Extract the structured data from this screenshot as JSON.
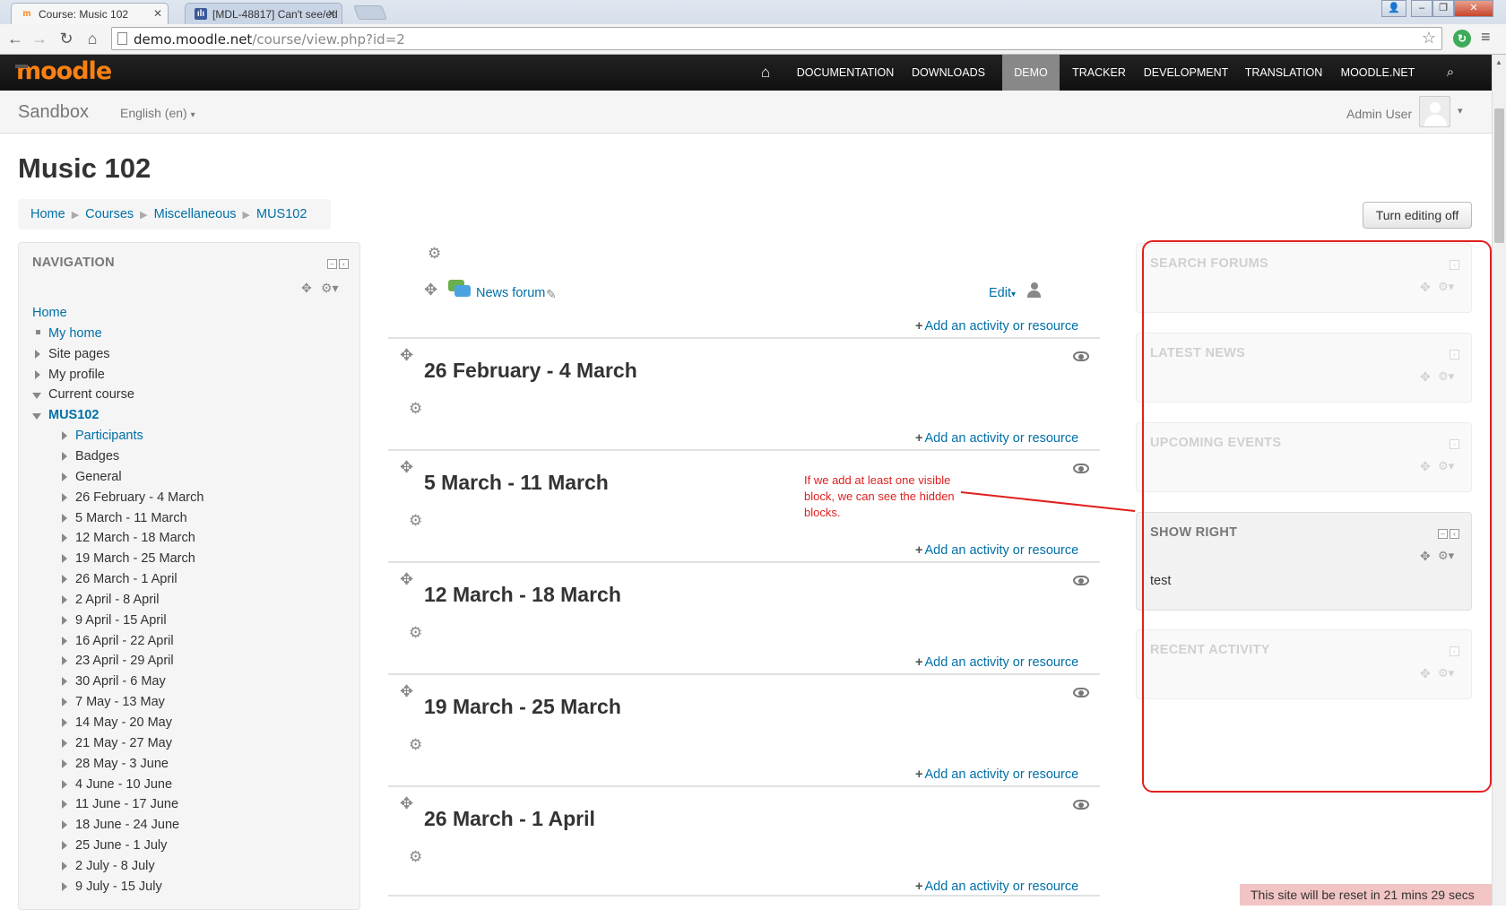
{
  "browser": {
    "tabs": [
      {
        "title": "Course: Music 102",
        "active": true
      },
      {
        "title": "[MDL-48817] Can't see/ed",
        "active": false
      }
    ],
    "url_domain": "demo.moodle.net",
    "url_path": "/course/view.php?id=2"
  },
  "header": {
    "logo": "moodle",
    "nav": [
      {
        "label": "DOCUMENTATION"
      },
      {
        "label": "DOWNLOADS"
      },
      {
        "label": "DEMO",
        "active": true
      },
      {
        "label": "TRACKER"
      },
      {
        "label": "DEVELOPMENT"
      },
      {
        "label": "TRANSLATION"
      },
      {
        "label": "MOODLE.NET"
      }
    ],
    "site_name": "Sandbox",
    "language": "English (en)",
    "user_name": "Admin User"
  },
  "page": {
    "title": "Music 102",
    "breadcrumb": [
      "Home",
      "Courses",
      "Miscellaneous",
      "MUS102"
    ],
    "editing_button": "Turn editing off"
  },
  "navigation_block": {
    "title": "NAVIGATION",
    "items": [
      {
        "label": "Home",
        "style": "link",
        "level": 0,
        "marker": "none"
      },
      {
        "label": "My home",
        "style": "link",
        "level": 1,
        "marker": "square"
      },
      {
        "label": "Site pages",
        "style": "plain",
        "level": 1,
        "marker": "collapsed"
      },
      {
        "label": "My profile",
        "style": "plain",
        "level": 1,
        "marker": "collapsed"
      },
      {
        "label": "Current course",
        "style": "plain",
        "level": 1,
        "marker": "expanded"
      },
      {
        "label": "MUS102",
        "style": "bold-link",
        "level": 2,
        "marker": "expanded"
      },
      {
        "label": "Participants",
        "style": "link",
        "level": 3,
        "marker": "collapsed"
      },
      {
        "label": "Badges",
        "style": "plain",
        "level": 3,
        "marker": "collapsed"
      },
      {
        "label": "General",
        "style": "plain",
        "level": 3,
        "marker": "collapsed"
      },
      {
        "label": "26 February - 4 March",
        "style": "plain",
        "level": 3,
        "marker": "collapsed"
      },
      {
        "label": "5 March - 11 March",
        "style": "plain",
        "level": 3,
        "marker": "collapsed"
      },
      {
        "label": "12 March - 18 March",
        "style": "plain",
        "level": 3,
        "marker": "collapsed"
      },
      {
        "label": "19 March - 25 March",
        "style": "plain",
        "level": 3,
        "marker": "collapsed"
      },
      {
        "label": "26 March - 1 April",
        "style": "plain",
        "level": 3,
        "marker": "collapsed"
      },
      {
        "label": "2 April - 8 April",
        "style": "plain",
        "level": 3,
        "marker": "collapsed"
      },
      {
        "label": "9 April - 15 April",
        "style": "plain",
        "level": 3,
        "marker": "collapsed"
      },
      {
        "label": "16 April - 22 April",
        "style": "plain",
        "level": 3,
        "marker": "collapsed"
      },
      {
        "label": "23 April - 29 April",
        "style": "plain",
        "level": 3,
        "marker": "collapsed"
      },
      {
        "label": "30 April - 6 May",
        "style": "plain",
        "level": 3,
        "marker": "collapsed"
      },
      {
        "label": "7 May - 13 May",
        "style": "plain",
        "level": 3,
        "marker": "collapsed"
      },
      {
        "label": "14 May - 20 May",
        "style": "plain",
        "level": 3,
        "marker": "collapsed"
      },
      {
        "label": "21 May - 27 May",
        "style": "plain",
        "level": 3,
        "marker": "collapsed"
      },
      {
        "label": "28 May - 3 June",
        "style": "plain",
        "level": 3,
        "marker": "collapsed"
      },
      {
        "label": "4 June - 10 June",
        "style": "plain",
        "level": 3,
        "marker": "collapsed"
      },
      {
        "label": "11 June - 17 June",
        "style": "plain",
        "level": 3,
        "marker": "collapsed"
      },
      {
        "label": "18 June - 24 June",
        "style": "plain",
        "level": 3,
        "marker": "collapsed"
      },
      {
        "label": "25 June - 1 July",
        "style": "plain",
        "level": 3,
        "marker": "collapsed"
      },
      {
        "label": "2 July - 8 July",
        "style": "plain",
        "level": 3,
        "marker": "collapsed"
      },
      {
        "label": "9 July - 15 July",
        "style": "plain",
        "level": 3,
        "marker": "collapsed"
      }
    ]
  },
  "course": {
    "forum_link": "News forum",
    "edit_label": "Edit",
    "add_activity_label": "Add an activity or resource",
    "sections": [
      {
        "title": "26 February - 4 March"
      },
      {
        "title": "5 March - 11 March"
      },
      {
        "title": "12 March - 18 March"
      },
      {
        "title": "19 March - 25 March"
      },
      {
        "title": "26 March - 1 April"
      }
    ]
  },
  "annotation": {
    "text": "If we add at least one visible block, we can see the hidden blocks.",
    "color": "#e0201f"
  },
  "right_blocks": [
    {
      "title": "SEARCH FORUMS",
      "hidden": true
    },
    {
      "title": "LATEST NEWS",
      "hidden": true
    },
    {
      "title": "UPCOMING EVENTS",
      "hidden": true
    },
    {
      "title": "SHOW RIGHT",
      "hidden": false,
      "content": "test"
    },
    {
      "title": "RECENT ACTIVITY",
      "hidden": true
    }
  ],
  "footer": {
    "reset_notice": "This site will be reset in 21 mins 29 secs"
  },
  "colors": {
    "link": "#0070a8",
    "navbar": "#111111",
    "brand": "#f98012",
    "annotation": "#e0201f"
  }
}
